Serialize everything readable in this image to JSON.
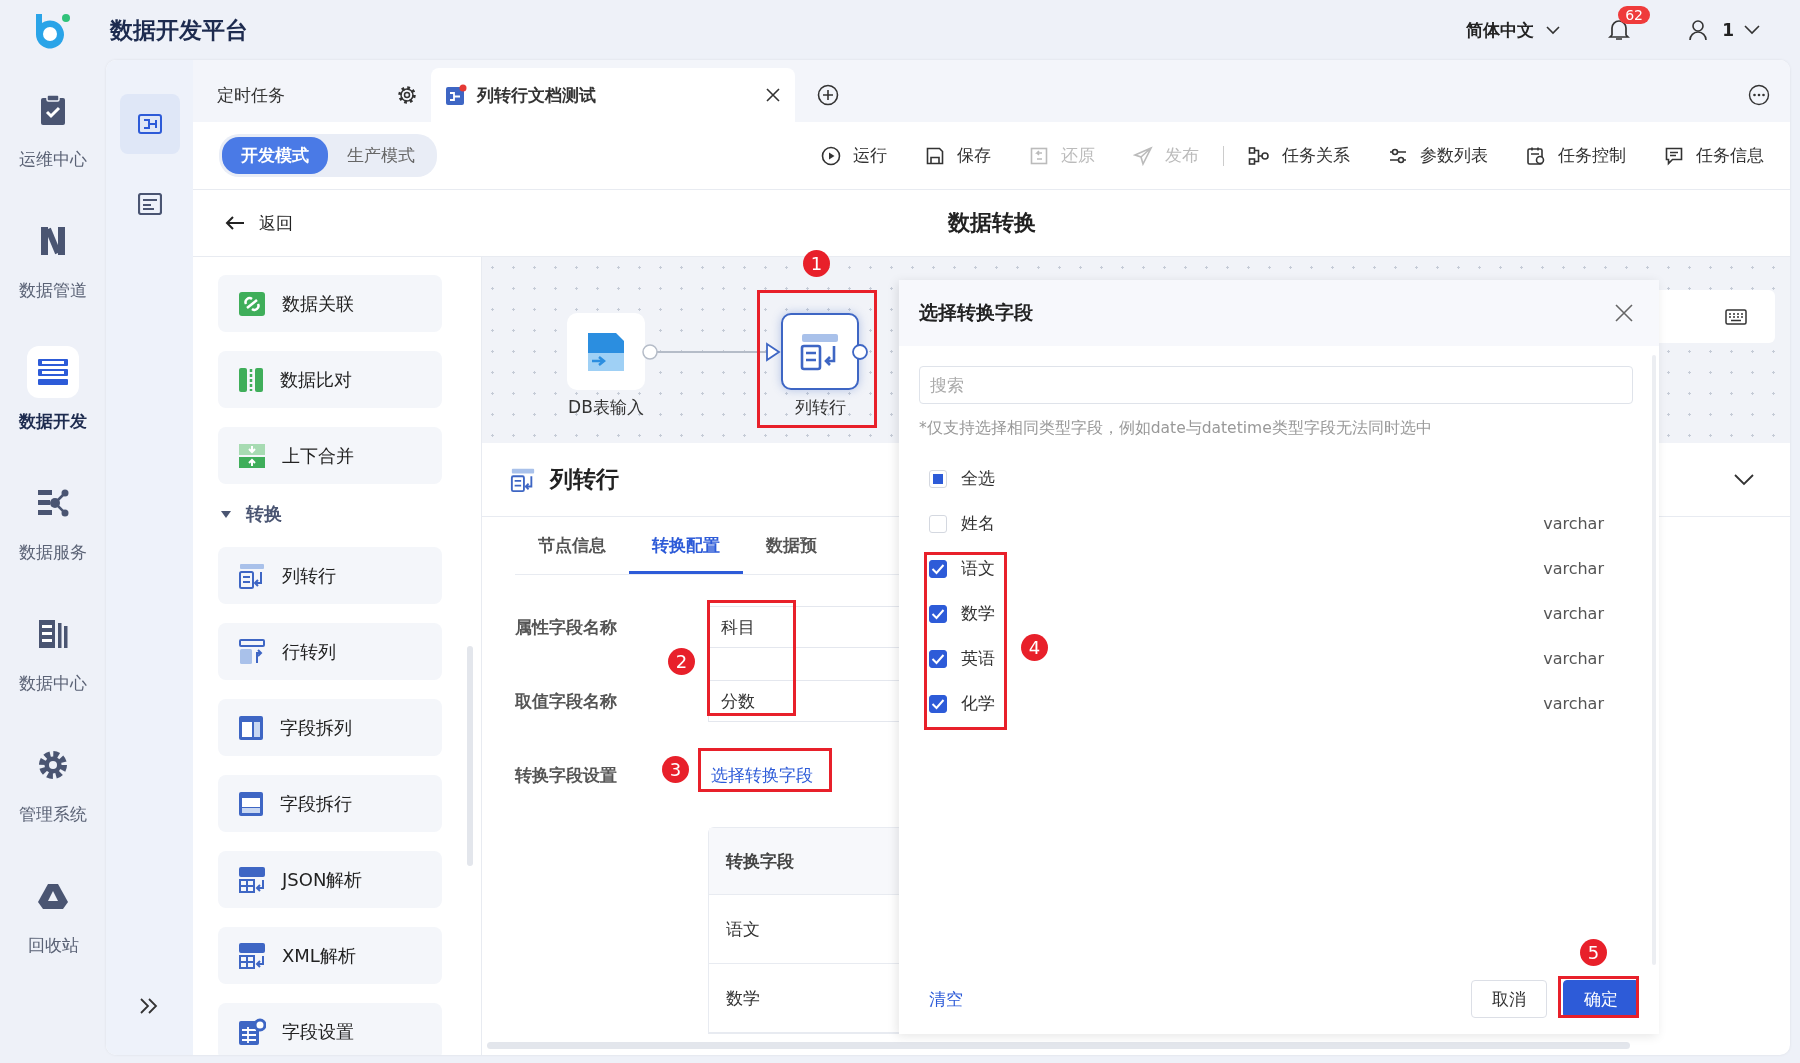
{
  "app": {
    "title": "数据开发平台"
  },
  "top_bar": {
    "language": "简体中文",
    "notifications": "62",
    "user": "1"
  },
  "nav": [
    {
      "label": "运维中心",
      "selected": false
    },
    {
      "label": "数据管道",
      "selected": false
    },
    {
      "label": "数据开发",
      "selected": true
    },
    {
      "label": "数据服务",
      "selected": false
    },
    {
      "label": "数据中心",
      "selected": false
    },
    {
      "label": "管理系统",
      "selected": false
    },
    {
      "label": "回收站",
      "selected": false
    }
  ],
  "subnav": [
    {
      "selected": true
    },
    {
      "selected": false
    }
  ],
  "tabs": [
    {
      "label": "定时任务",
      "selected": false
    },
    {
      "label": "列转行文档测试",
      "selected": true
    }
  ],
  "modes": [
    {
      "label": "开发模式",
      "selected": true
    },
    {
      "label": "生产模式",
      "selected": false
    }
  ],
  "actions": [
    {
      "label": "运行",
      "disabled": false
    },
    {
      "label": "保存",
      "disabled": false
    },
    {
      "label": "还原",
      "disabled": true
    },
    {
      "label": "发布",
      "disabled": true
    },
    {
      "label": "任务关系",
      "disabled": false
    },
    {
      "label": "参数列表",
      "disabled": false
    },
    {
      "label": "任务控制",
      "disabled": false
    },
    {
      "label": "任务信息",
      "disabled": false
    }
  ],
  "header": {
    "back": "返回",
    "title": "数据转换"
  },
  "components": [
    {
      "kind": "item",
      "label": "数据关联"
    },
    {
      "kind": "item",
      "label": "数据比对"
    },
    {
      "kind": "item",
      "label": "上下合并"
    },
    {
      "kind": "section",
      "label": "转换",
      "expanded": true
    },
    {
      "kind": "item",
      "label": "列转行"
    },
    {
      "kind": "item",
      "label": "行转列"
    },
    {
      "kind": "item",
      "label": "字段拆列"
    },
    {
      "kind": "item",
      "label": "字段拆行"
    },
    {
      "kind": "item",
      "label": "JSON解析"
    },
    {
      "kind": "item",
      "label": "XML解析"
    },
    {
      "kind": "item",
      "label": "字段设置"
    }
  ],
  "canvas": {
    "nodes": [
      {
        "label": "DB表输入",
        "selected": false
      },
      {
        "label": "列转行",
        "selected": true
      }
    ]
  },
  "node_panel": {
    "title": "列转行",
    "tabs": [
      {
        "label": "节点信息",
        "selected": false
      },
      {
        "label": "转换配置",
        "selected": true
      },
      {
        "label": "数据预",
        "selected": false
      }
    ],
    "form": [
      {
        "kind": "input",
        "label": "属性字段名称",
        "value": "科目"
      },
      {
        "kind": "input",
        "label": "取值字段名称",
        "value": "分数"
      },
      {
        "kind": "link",
        "label": "转换字段设置",
        "value": "选择转换字段"
      }
    ],
    "table": {
      "columns": [
        "转换字段"
      ],
      "rows": [
        "语文",
        "数学"
      ]
    }
  },
  "dialog": {
    "title": "选择转换字段",
    "search": {
      "placeholder": "搜索"
    },
    "note": "*仅支持选择相同类型字段，例如date与datetime类型字段无法同时选中",
    "select_all": {
      "label": "全选",
      "checked": false,
      "indeterminate": true
    },
    "fields": [
      {
        "name": "姓名",
        "type": "varchar",
        "checked": false
      },
      {
        "name": "语文",
        "type": "varchar",
        "checked": true
      },
      {
        "name": "数学",
        "type": "varchar",
        "checked": true
      },
      {
        "name": "英语",
        "type": "varchar",
        "checked": true
      },
      {
        "name": "化学",
        "type": "varchar",
        "checked": true
      }
    ],
    "clear": "清空",
    "buttons": [
      {
        "label": "取消",
        "primary": false
      },
      {
        "label": "确定",
        "primary": true
      }
    ]
  },
  "annotations": [
    "1",
    "2",
    "3",
    "4",
    "5"
  ]
}
